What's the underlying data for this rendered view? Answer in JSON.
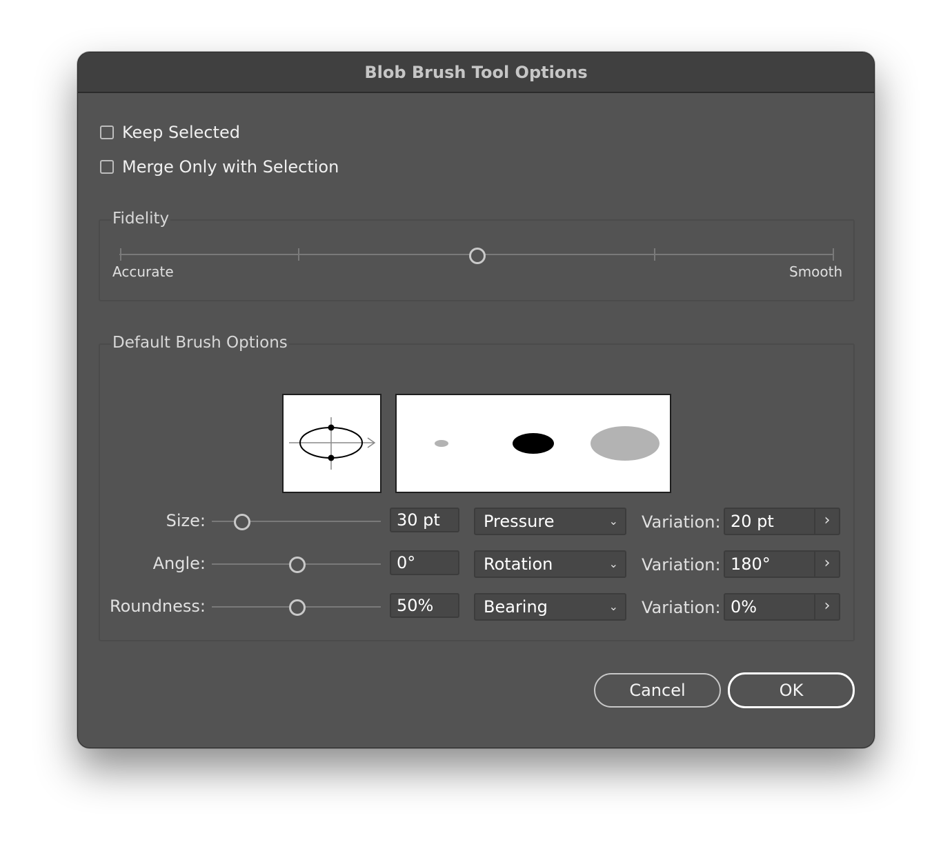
{
  "dialog": {
    "title": "Blob Brush Tool Options"
  },
  "options": {
    "keep_selected": {
      "label": "Keep Selected",
      "checked": false
    },
    "merge_only": {
      "label": "Merge Only with Selection",
      "checked": false
    }
  },
  "fidelity": {
    "label": "Fidelity",
    "min_label": "Accurate",
    "max_label": "Smooth",
    "value_fraction": 0.5
  },
  "brush": {
    "label": "Default Brush Options",
    "rows": [
      {
        "label": "Size:",
        "value": "30 pt",
        "slider_fraction": 0.18,
        "mode": "Pressure",
        "variation_label": "Variation:",
        "variation": "20 pt"
      },
      {
        "label": "Angle:",
        "value": "0°",
        "slider_fraction": 0.5,
        "mode": "Rotation",
        "variation_label": "Variation:",
        "variation": "180°"
      },
      {
        "label": "Roundness:",
        "value": "50%",
        "slider_fraction": 0.5,
        "mode": "Bearing",
        "variation_label": "Variation:",
        "variation": "0%"
      }
    ]
  },
  "buttons": {
    "cancel": "Cancel",
    "ok": "OK"
  },
  "colors": {
    "dialog_bg": "#535353",
    "titlebar_bg": "#404040",
    "field_bg": "#474747",
    "accent_ellipse": "#000000",
    "preview_gray": "#b3b3b3"
  },
  "icons": {
    "dropdown": "chevron-down-icon",
    "stepper": "chevron-right-icon"
  }
}
